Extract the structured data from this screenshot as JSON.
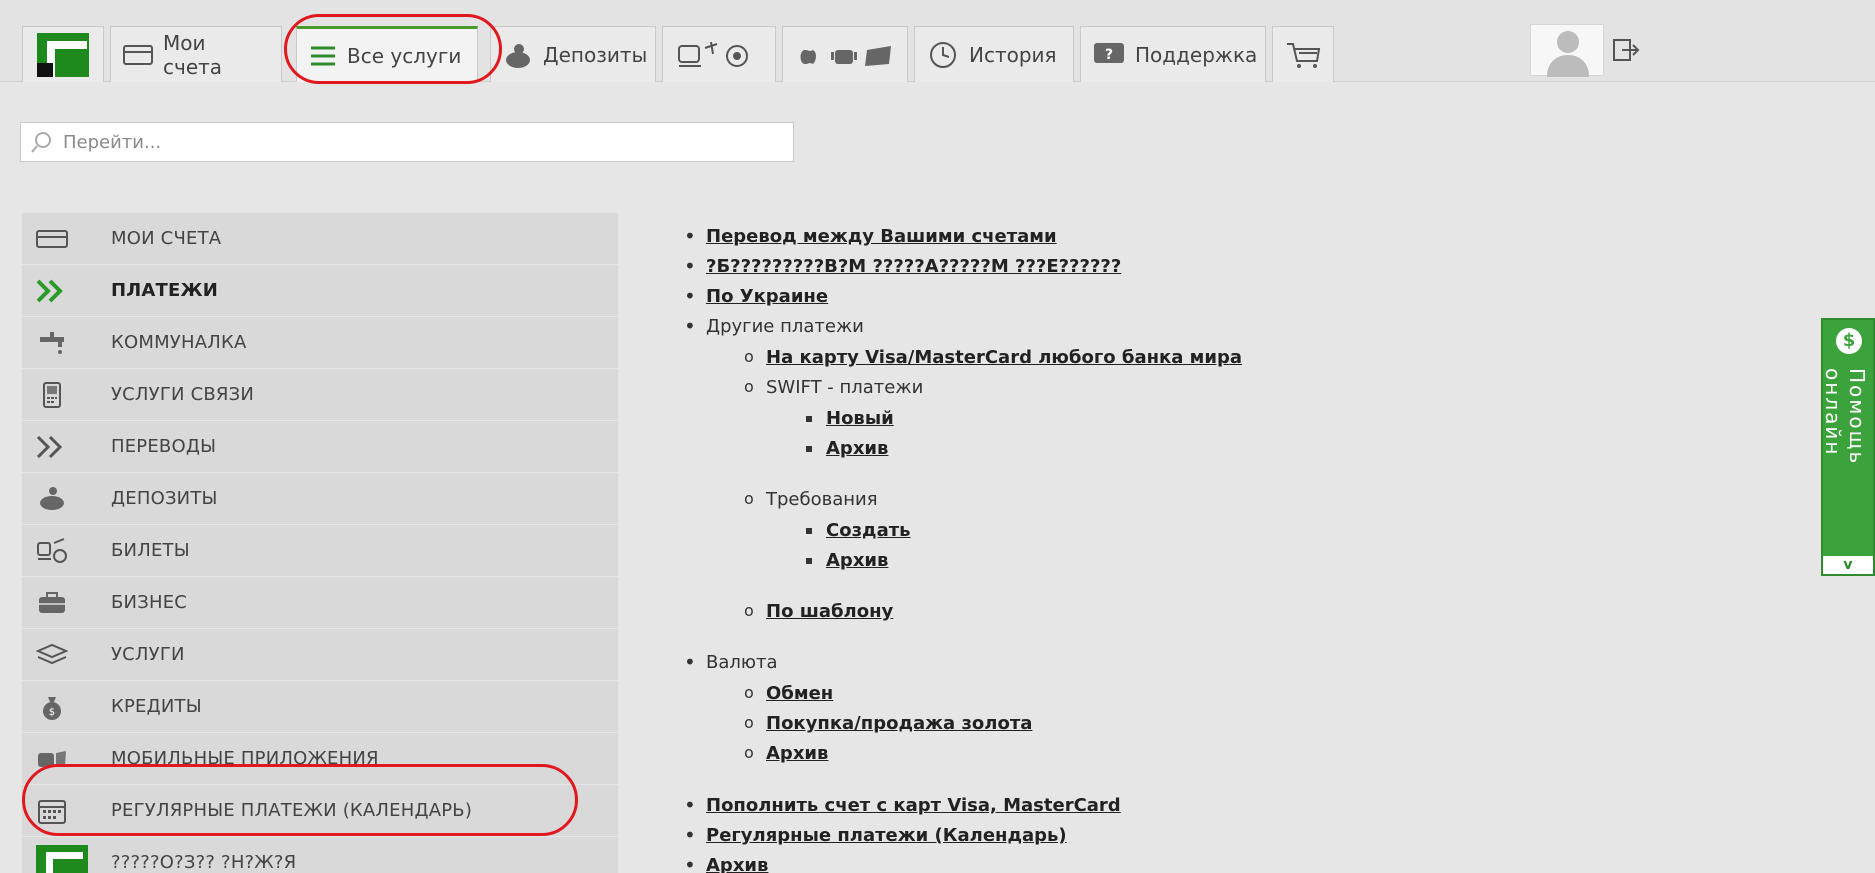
{
  "nav": {
    "tabs": [
      {
        "label": "Мои счета",
        "icon": "card-icon"
      },
      {
        "label": "Все услуги",
        "icon": "list-icon"
      },
      {
        "label": "Депозиты",
        "icon": "piggy-icon"
      },
      {
        "label": "",
        "icon": "tickets-icon"
      },
      {
        "label": "",
        "icon": "mobile-apps-icon"
      },
      {
        "label": "История",
        "icon": "history-icon"
      },
      {
        "label": "Поддержка",
        "icon": "support-icon"
      },
      {
        "label": "",
        "icon": "cart-icon"
      }
    ]
  },
  "search": {
    "placeholder": "Перейти..."
  },
  "sidebar": {
    "items": [
      {
        "label": "МОИ СЧЕТА",
        "icon": "card-icon"
      },
      {
        "label": "ПЛАТЕЖИ",
        "icon": "double-chevron-icon"
      },
      {
        "label": "КОММУНАЛКА",
        "icon": "faucet-icon"
      },
      {
        "label": "УСЛУГИ СВЯЗИ",
        "icon": "phone-icon"
      },
      {
        "label": "ПЕРЕВОДЫ",
        "icon": "double-chevron-icon"
      },
      {
        "label": "ДЕПОЗИТЫ",
        "icon": "piggy-icon"
      },
      {
        "label": "БИЛЕТЫ",
        "icon": "tickets-icon"
      },
      {
        "label": "БИЗНЕС",
        "icon": "briefcase-icon"
      },
      {
        "label": "УСЛУГИ",
        "icon": "services-icon"
      },
      {
        "label": "КРЕДИТЫ",
        "icon": "money-bag-icon"
      },
      {
        "label": "МОБИЛЬНЫЕ ПРИЛОЖЕНИЯ",
        "icon": "mobile-apps-icon"
      },
      {
        "label": "РЕГУЛЯРНЫЕ ПЛАТЕЖИ (КАЛЕНДАРЬ)",
        "icon": "calendar-icon"
      },
      {
        "label": "?????О?З?? ?Н?Ж?Я",
        "icon": "bank-logo-icon"
      }
    ]
  },
  "content": {
    "l1_transfer": "Перевод между Вашими счетами",
    "l1_garbled": "?Б?????????В?М ?????А?????М ???Е??????",
    "l1_ukraine": "По Украине",
    "l1_other": "Другие платежи",
    "l2_visa_card": "На карту Visa/MasterCard любого банка мира",
    "l2_swift": "SWIFT - платежи",
    "l3_new": "Новый",
    "l3_archive1": "Архив",
    "l2_requirements": "Требования",
    "l3_create": "Создать",
    "l3_archive2": "Архив",
    "l2_template": "По шаблону",
    "l1_currency": "Валюта",
    "l2_exchange": "Обмен",
    "l2_gold": "Покупка/продажа золота",
    "l2_archive": "Архив",
    "l1_topup": "Пополнить счет с карт Visa, MasterCard",
    "l1_regular": "Регулярные платежи (Календарь)",
    "l1_archive": "Архив"
  },
  "help": {
    "label": "Помощь онлайн",
    "collapse": "v",
    "icon_glyph": "$"
  }
}
